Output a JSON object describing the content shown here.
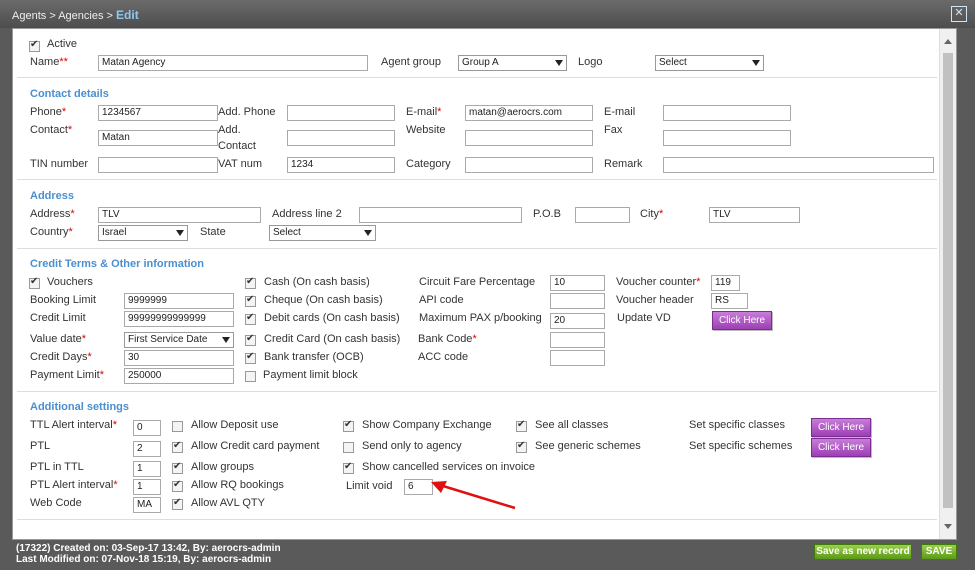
{
  "breadcrumb": {
    "part1": "Agents",
    "sep1": ">",
    "part2": "Agencies",
    "sep2": ">",
    "current": "Edit"
  },
  "close_symbol": "✕",
  "general": {
    "active_label": "Active",
    "name_label": "Name",
    "name_req": "**",
    "name_value": "Matan Agency",
    "agent_group_label": "Agent group",
    "agent_group_value": "Group A",
    "logo_label": "Logo",
    "logo_value": "Select"
  },
  "contact": {
    "title": "Contact details",
    "phone_label": "Phone",
    "phone_value": "1234567",
    "add_phone_label": "Add. Phone",
    "add_phone_value": "",
    "email_label": "E-mail",
    "email_value": "matan@aerocrs.com",
    "email2_label": "E-mail",
    "email2_value": "",
    "contact_label": "Contact",
    "contact_value": "Matan",
    "add_contact_label1": "Add.",
    "add_contact_label2": "Contact",
    "add_contact_value": "",
    "website_label": "Website",
    "website_value": "",
    "fax_label": "Fax",
    "fax_value": "",
    "tin_label": "TIN number",
    "tin_value": "",
    "vat_label": "VAT num",
    "vat_value": "1234",
    "category_label": "Category",
    "category_value": "",
    "remark_label": "Remark",
    "remark_value": ""
  },
  "address": {
    "title": "Address",
    "address_label": "Address",
    "address_value": "TLV",
    "line2_label": "Address line 2",
    "line2_value": "",
    "pob_label": "P.O.B",
    "pob_value": "",
    "city_label": "City",
    "city_value": "TLV",
    "country_label": "Country",
    "country_value": "Israel",
    "state_label": "State",
    "state_value": "Select"
  },
  "credit": {
    "title": "Credit Terms & Other information",
    "vouchers_label": "Vouchers",
    "booking_limit_label": "Booking Limit",
    "booking_limit_value": "9999999",
    "credit_limit_label": "Credit Limit",
    "credit_limit_value": "99999999999999",
    "value_date_label": "Value date",
    "value_date_value": "First Service Date",
    "credit_days_label": "Credit Days",
    "credit_days_value": "30",
    "payment_limit_label": "Payment Limit",
    "payment_limit_value": "250000",
    "cash_label": "Cash (On cash basis)",
    "cheque_label": "Cheque (On cash basis)",
    "debit_label": "Debit cards (On cash basis)",
    "credit_card_label": "Credit Card (On cash basis)",
    "bank_transfer_label": "Bank transfer (OCB)",
    "payment_block_label": "Payment limit block",
    "circuit_label": "Circuit Fare Percentage",
    "circuit_value": "10",
    "api_label": "API code",
    "api_value": "",
    "max_pax_label": "Maximum PAX p/booking",
    "max_pax_value": "20",
    "bank_code_label": "Bank Code",
    "bank_code_value": "",
    "acc_label": "ACC code",
    "acc_value": "",
    "voucher_counter_label": "Voucher counter",
    "voucher_counter_value": "119",
    "voucher_header_label": "Voucher header",
    "voucher_header_value": "RS",
    "update_vd_label": "Update VD",
    "click_here": "Click Here"
  },
  "additional": {
    "title": "Additional settings",
    "ttl_label": "TTL Alert interval",
    "ttl_value": "0",
    "ptl_label": "PTL",
    "ptl_value": "2",
    "ptl_ttl_label": "PTL in TTL",
    "ptl_ttl_value": "1",
    "ptl_alert_label": "PTL Alert interval",
    "ptl_alert_value": "1",
    "web_code_label": "Web Code",
    "web_code_value": "MA",
    "allow_deposit": "Allow Deposit use",
    "allow_cc": "Allow Credit card payment",
    "allow_groups": "Allow groups",
    "allow_rq": "Allow RQ bookings",
    "allow_avl": "Allow AVL QTY",
    "show_exchange": "Show Company Exchange",
    "send_agency": "Send only to agency",
    "show_cancelled": "Show cancelled services on invoice",
    "limit_void_label": "Limit void",
    "limit_void_value": "6",
    "see_classes": "See all classes",
    "see_schemes": "See generic schemes",
    "set_classes": "Set specific classes",
    "set_schemes": "Set specific schemes",
    "click_here": "Click Here"
  },
  "footer": {
    "created": "(17322) Created on: 03-Sep-17 13:42, By: aerocrs-admin",
    "modified": "Last Modified on: 07-Nov-18 15:19, By: aerocrs-admin",
    "save_new": "Save as new record",
    "save": "SAVE"
  },
  "colors": {
    "accent": "#4a8fd0",
    "required": "#dd0000",
    "purple_button": "#9c3fb4",
    "green_button": "#5a9a18"
  }
}
